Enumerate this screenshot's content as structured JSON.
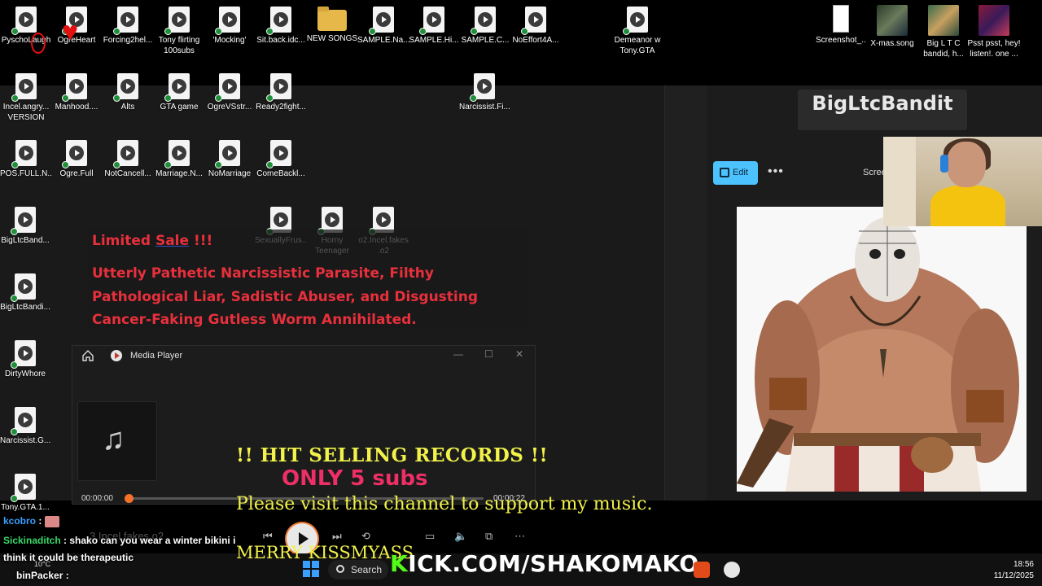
{
  "desktop": {
    "row1": [
      {
        "label": "PyschoLaugh",
        "type": "video"
      },
      {
        "label": "OgreHeart",
        "type": "video"
      },
      {
        "label": "Forcing2hel...",
        "type": "video"
      },
      {
        "label": "Tony flirting\n100subs",
        "type": "video"
      },
      {
        "label": "'Mocking'",
        "type": "video"
      },
      {
        "label": "Sit.back.idc...",
        "type": "video"
      },
      {
        "label": "NEW SONGS",
        "type": "folder"
      },
      {
        "label": "SAMPLE.Na...",
        "type": "video"
      },
      {
        "label": "SAMPLE.Hi...",
        "type": "video"
      },
      {
        "label": "SAMPLE.C...",
        "type": "video"
      },
      {
        "label": "NoEffort4A...",
        "type": "video"
      }
    ],
    "demeanor": "Demeanor w\nTony.GTA",
    "right_icons": [
      {
        "label": "Screenshot_..."
      },
      {
        "label": "X-mas.song"
      },
      {
        "label": "Big L T C\nbandid, h..."
      },
      {
        "label": "Psst psst, hey!\nlisten!. one ..."
      }
    ],
    "row2": [
      {
        "label": "Incel.angry...\nVERSION"
      },
      {
        "label": "Manhood...."
      },
      {
        "label": "Alts"
      },
      {
        "label": "GTA game"
      },
      {
        "label": "OgreVSstr..."
      },
      {
        "label": "Ready2fight..."
      }
    ],
    "narcissist_top": "Narcissist.Fi...",
    "row3": [
      {
        "label": "POS.FULL.N..."
      },
      {
        "label": "Ogre.Full"
      },
      {
        "label": "NotCancell..."
      },
      {
        "label": "Marriage.N..."
      },
      {
        "label": "NoMarriage"
      },
      {
        "label": "ComeBackl..."
      }
    ],
    "row4": [
      {
        "label": "SexuallyFrus..."
      },
      {
        "label": "Horny\nTeenager"
      },
      {
        "label": "o2.Incel.fakes\n.o2"
      }
    ],
    "col1": [
      {
        "label": "BigLtcBand..."
      },
      {
        "label": "BigLtcBandi..."
      },
      {
        "label": "DirtyWhore"
      },
      {
        "label": "Narcissist.G..."
      },
      {
        "label": "Tony.GTA.1..."
      }
    ]
  },
  "sale": {
    "title_a": "Limited ",
    "title_b": "Sale",
    "title_c": " !!!",
    "body": "Utterly Pathetic Narcissistic Parasite, Filthy Pathological Liar, Sadistic Abuser, and Disgusting Cancer-Faking Gutless Worm Annihilated."
  },
  "photos": {
    "brand": "BigLtcBandit",
    "edit_label": "Edit",
    "more_label": "•••",
    "scre_label": "Scree"
  },
  "media_player": {
    "title": "Media Player",
    "time_current": "00:00:00",
    "time_total": "00:00:22",
    "progress": 0.0,
    "faded_title": "3.Incel.fakes.o2",
    "minimize": "—",
    "maximize": "☐",
    "close": "✕"
  },
  "overlay": {
    "hit": "!! HIT SELLING RECORDS !!",
    "only": "ONLY 5 subs",
    "visit": "Please visit this channel to support my music.",
    "merry": "MERRY KISSMYASS"
  },
  "chat": [
    {
      "user": "kcobro",
      "sep": " : ",
      "text": ""
    },
    {
      "user": "Sickinaditch",
      "sep": " : ",
      "text": "shako can you wear a winter bikini i"
    },
    {
      "user": "",
      "sep": "",
      "text": "think it could be therapeutic"
    },
    {
      "user": "binPacker",
      "sep": " : ",
      "text": ""
    }
  ],
  "taskbar": {
    "search": "Search",
    "kick_k": "K",
    "kick_rest": "ICK.COM/SHAKOMAKO",
    "weather": "10°C",
    "time": "18:56",
    "date": "11/12/2025"
  },
  "colors": {
    "accent": "#4cc2ff",
    "kick_green": "#53fc18",
    "sale_red": "#e8303c",
    "overlay_yellow": "#f2f24a",
    "overlay_pink": "#ee2f66"
  }
}
